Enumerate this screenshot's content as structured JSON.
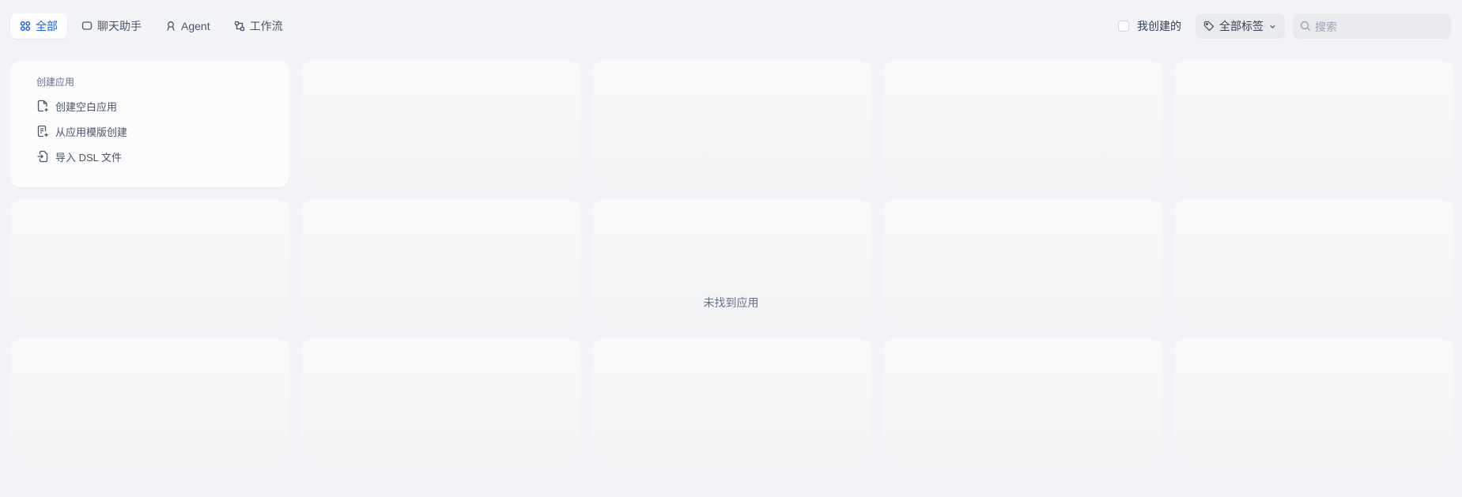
{
  "tabs": [
    {
      "label": "全部",
      "icon": "grid-icon",
      "active": true
    },
    {
      "label": "聊天助手",
      "icon": "chat-icon",
      "active": false
    },
    {
      "label": "Agent",
      "icon": "agent-icon",
      "active": false
    },
    {
      "label": "工作流",
      "icon": "workflow-icon",
      "active": false
    }
  ],
  "filters": {
    "mine_label": "我创建的",
    "mine_checked": false,
    "tag_label": "全部标签",
    "search_placeholder": "搜索",
    "search_value": ""
  },
  "create_card": {
    "title": "创建应用",
    "items": [
      {
        "label": "创建空白应用",
        "icon": "file-plus-icon"
      },
      {
        "label": "从应用模版创建",
        "icon": "template-icon"
      },
      {
        "label": "导入 DSL 文件",
        "icon": "import-icon"
      }
    ]
  },
  "empty_message": "未找到应用",
  "colors": {
    "accent": "#155eef",
    "page_bg": "#f2f4f7"
  }
}
